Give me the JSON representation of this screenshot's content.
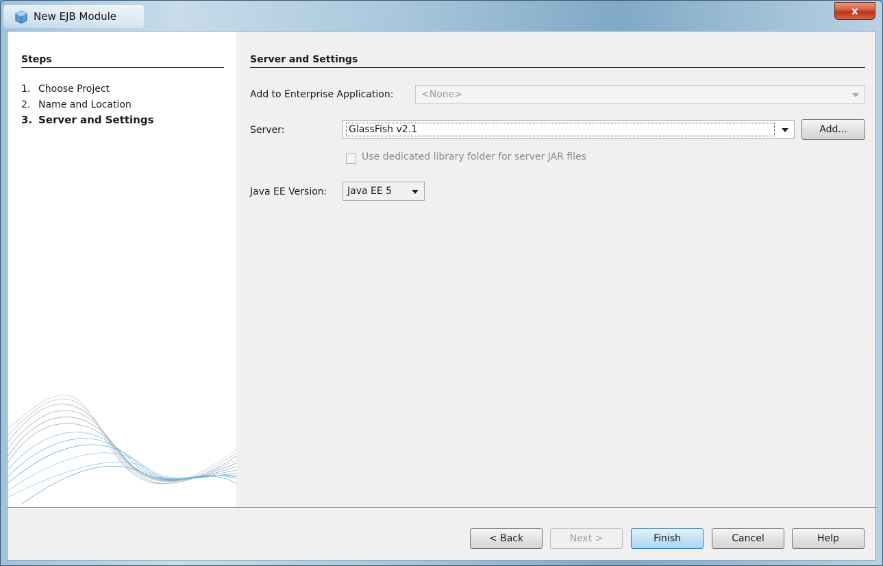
{
  "window": {
    "title": "New EJB Module",
    "close_label": "x"
  },
  "steps": {
    "title": "Steps",
    "items": [
      {
        "num": "1.",
        "label": "Choose Project"
      },
      {
        "num": "2.",
        "label": "Name and Location"
      },
      {
        "num": "3.",
        "label": "Server and Settings"
      }
    ]
  },
  "content": {
    "section_title": "Server and Settings",
    "enterprise_app": {
      "label": "Add to Enterprise Application:",
      "value": "<None>"
    },
    "server": {
      "label": "Server:",
      "value": "GlassFish v2.1",
      "add_label": "Add..."
    },
    "dedicated_lib": {
      "label": "Use dedicated library folder for server JAR files",
      "checked": false
    },
    "javaee": {
      "label": "Java EE Version:",
      "value": "Java EE 5"
    }
  },
  "buttons": {
    "back": "< Back",
    "next": "Next >",
    "finish": "Finish",
    "cancel": "Cancel",
    "help": "Help"
  }
}
